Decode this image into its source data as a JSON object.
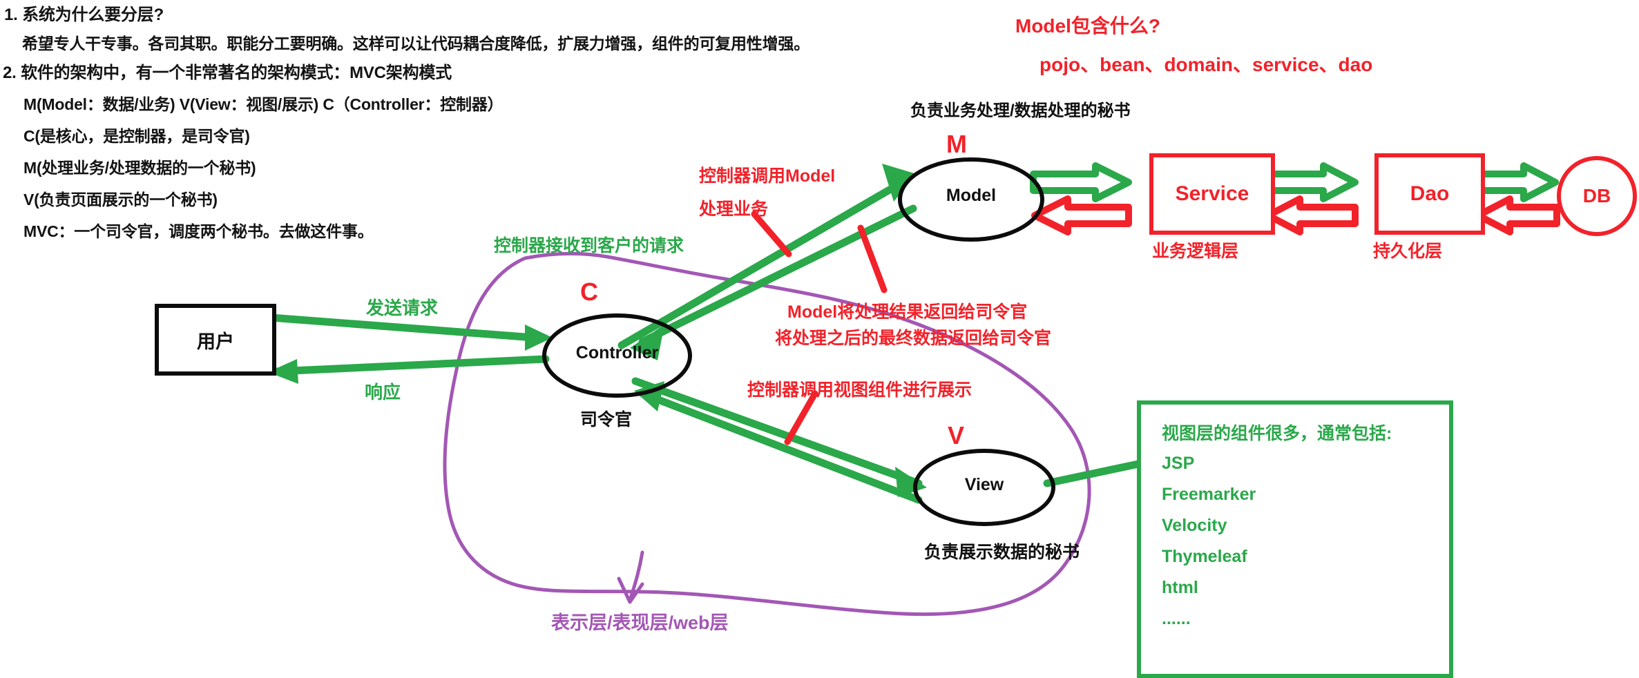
{
  "notes": {
    "lines": [
      "1. 系统为什么要分层?",
      "希望专人干专事。各司其职。职能分工要明确。这样可以让代码耦合度降低，扩展力增强，组件的可复用性增强。",
      "2. 软件的架构中，有一个非常著名的架构模式：MVC架构模式",
      "M(Model：数据/业务)  V(View：视图/展示) C（Controller：控制器）",
      "C(是核心，是控制器，是司令官)",
      "M(处理业务/处理数据的一个秘书)",
      "V(负责页面展示的一个秘书)",
      "MVC：一个司令官，调度两个秘书。去做这件事。"
    ]
  },
  "model_note": {
    "question": "Model包含什么?",
    "answer": "pojo、bean、domain、service、dao"
  },
  "nodes": {
    "user": {
      "label": "用户"
    },
    "controller": {
      "tag": "C",
      "label": "Controller",
      "caption": "司令官"
    },
    "model": {
      "tag": "M",
      "label": "Model",
      "caption": "负责业务处理/数据处理的秘书"
    },
    "view": {
      "tag": "V",
      "label": "View",
      "caption": "负责展示数据的秘书"
    },
    "service": {
      "label": "Service",
      "caption": "业务逻辑层"
    },
    "dao": {
      "label": "Dao",
      "caption": "持久化层"
    },
    "db": {
      "label": "DB"
    }
  },
  "edge_labels": {
    "send_request": "发送请求",
    "response": "响应",
    "controller_receives": "控制器接收到客户的请求",
    "controller_calls_model_l1": "控制器调用Model",
    "controller_calls_model_l2": "处理业务",
    "model_returns_l1": "Model将处理结果返回给司令官",
    "model_returns_l2": "将处理之后的最终数据返回给司令官",
    "controller_calls_view": "控制器调用视图组件进行展示",
    "web_layer": "表示层/表现层/web层"
  },
  "view_components": {
    "title": "视图层的组件很多，通常包括:",
    "items": [
      "JSP",
      "Freemarker",
      "Velocity",
      "Thymeleaf",
      "html",
      "......"
    ]
  },
  "colors": {
    "red": "#f2222a",
    "green": "#2aa84a",
    "purple": "#a357b5",
    "black": "#101010"
  }
}
